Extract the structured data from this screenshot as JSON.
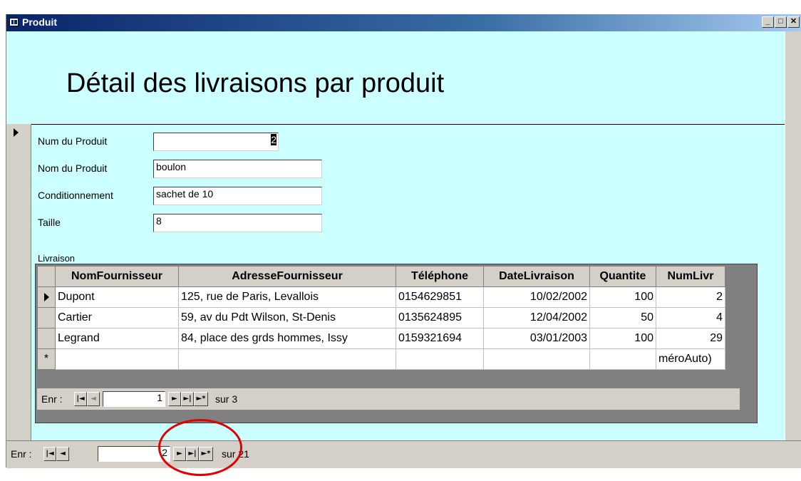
{
  "window": {
    "title": "Produit",
    "min": "_",
    "max": "□",
    "close": "✕"
  },
  "form": {
    "title": "Détail des livraisons par produit",
    "fields": [
      {
        "label": "Num du Produit",
        "value": "2"
      },
      {
        "label": "Nom du Produit",
        "value": "boulon"
      },
      {
        "label": "Conditionnement",
        "value": "sachet de 10"
      },
      {
        "label": "Taille",
        "value": "8"
      }
    ],
    "subform_label": "Livraison"
  },
  "subform": {
    "columns": [
      "NomFournisseur",
      "AdresseFournisseur",
      "Téléphone",
      "DateLivraison",
      "Quantite",
      "NumLivr"
    ],
    "rows": [
      [
        "Dupont",
        "125, rue de Paris, Levallois",
        "0154629851",
        "10/02/2002",
        "100",
        "2"
      ],
      [
        "Cartier",
        "59, av du Pdt Wilson, St-Denis",
        "0135624895",
        "12/04/2002",
        "50",
        "4"
      ],
      [
        "Legrand",
        "84, place des grds hommes, Issy",
        "0159321694",
        "03/01/2003",
        "100",
        "29"
      ]
    ],
    "new_row_marker": "*",
    "new_row_auto": "méroAuto)",
    "nav": {
      "label": "Enr :",
      "current": "1",
      "total": "sur 3"
    }
  },
  "main_nav": {
    "label": "Enr :",
    "current": "2",
    "total": "sur 21"
  },
  "nav_buttons": {
    "first": "|◄",
    "prev": "◄",
    "next": "►",
    "last": "►|",
    "new": "►*"
  },
  "colors": {
    "form_bg": "#ccffff",
    "annotation": "#e00000",
    "titlebar": "#0a246a"
  }
}
